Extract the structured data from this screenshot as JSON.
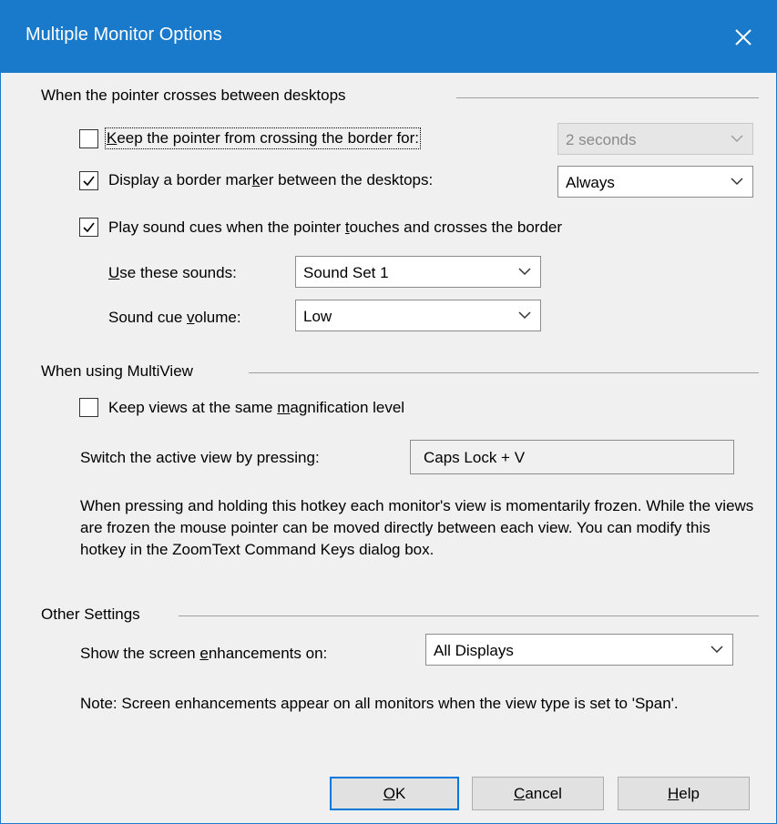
{
  "window": {
    "title": "Multiple Monitor Options",
    "accent": "#1979ca"
  },
  "pointer_group": {
    "label": "When the pointer crosses between desktops",
    "keep_pointer": {
      "label_pre": "",
      "label_ul": "K",
      "label_post": "eep the pointer from crossing the border for:",
      "checked": false,
      "combo_value": "2 seconds",
      "combo_disabled": true
    },
    "border_marker": {
      "label_pre": "Display a border mar",
      "label_ul": "k",
      "label_post": "er between the desktops:",
      "checked": true,
      "combo_value": "Always"
    },
    "sound_cues": {
      "label_pre": "Play sound cues when the pointer ",
      "label_ul": "t",
      "label_post": "ouches and crosses the border",
      "checked": true
    },
    "sounds": {
      "label_pre": "",
      "label_ul": "U",
      "label_post": "se these sounds:",
      "combo_value": "Sound Set 1"
    },
    "volume": {
      "label_pre": "Sound cue ",
      "label_ul": "v",
      "label_post": "olume:",
      "combo_value": "Low"
    }
  },
  "multiview_group": {
    "label": "When using MultiView",
    "keep_views": {
      "label_pre": "Keep views at the same ",
      "label_ul": "m",
      "label_post": "agnification level",
      "checked": false
    },
    "switch_label": "Switch the active view by pressing:",
    "hotkey_value": "Caps Lock + V",
    "description": "When pressing and holding this hotkey each monitor's view is momentarily frozen.  While the views are frozen the mouse pointer can be moved directly between each view.  You can modify this hotkey in the ZoomText Command Keys dialog box."
  },
  "other_group": {
    "label": "Other Settings",
    "show_on": {
      "label_pre": "Show the screen ",
      "label_ul": "e",
      "label_post": "nhancements on:",
      "combo_value": "All Displays"
    },
    "note": "Note: Screen enhancements appear on all monitors when the view type is set to 'Span'."
  },
  "buttons": {
    "ok": {
      "ul": "O",
      "rest": "K"
    },
    "cancel": {
      "ul": "C",
      "rest": "ancel"
    },
    "help": {
      "ul": "H",
      "rest": "elp"
    }
  }
}
